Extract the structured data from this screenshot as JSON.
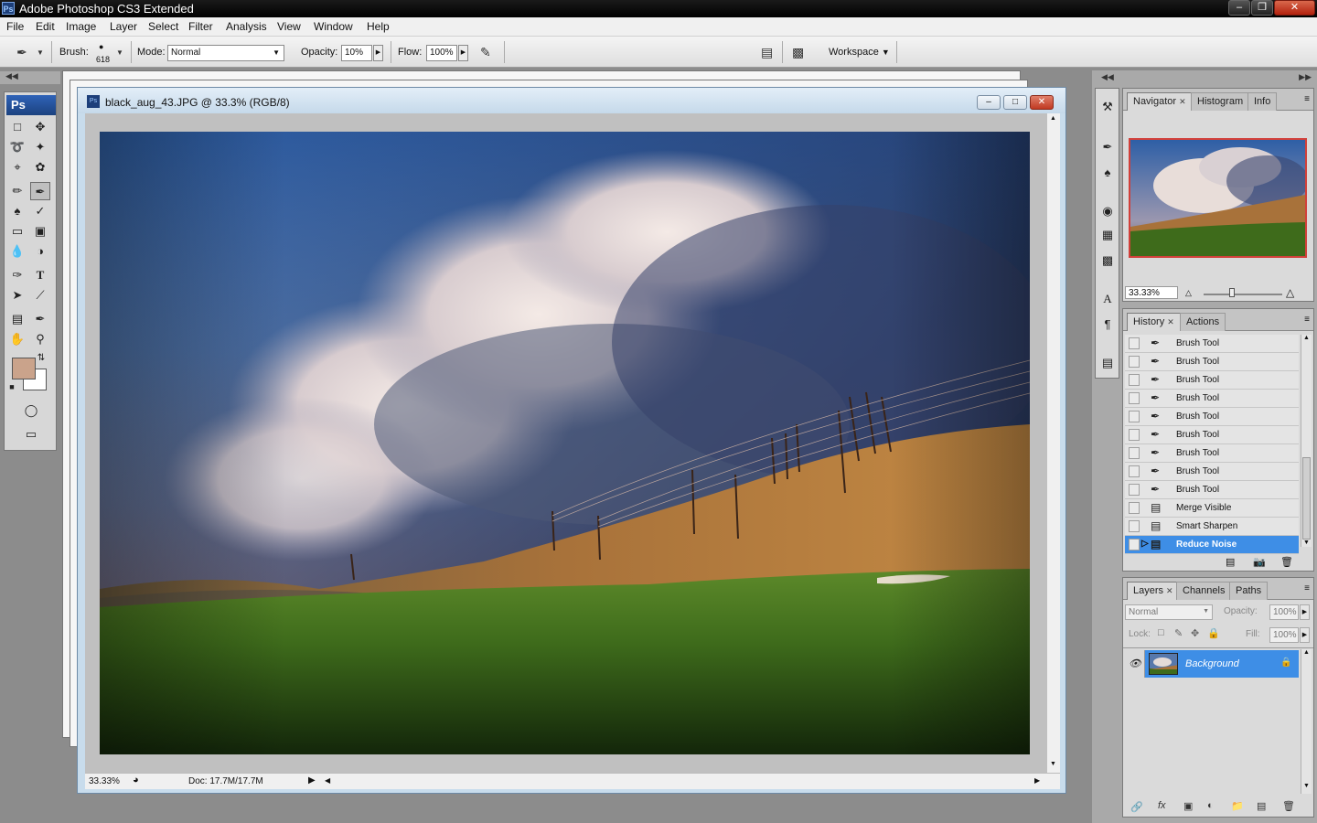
{
  "app": {
    "title": "Adobe Photoshop CS3 Extended",
    "badge": "Ps"
  },
  "menu": [
    "File",
    "Edit",
    "Image",
    "Layer",
    "Select",
    "Filter",
    "Analysis",
    "View",
    "Window",
    "Help"
  ],
  "options": {
    "brush_label": "Brush:",
    "brush_size": "618",
    "mode_label": "Mode:",
    "mode_value": "Normal",
    "opacity_label": "Opacity:",
    "opacity_value": "10%",
    "flow_label": "Flow:",
    "flow_value": "100%",
    "workspace_label": "Workspace"
  },
  "toolbox": {
    "badge": "Ps",
    "fg_color": "#caa38b",
    "bg_color": "#ffffff"
  },
  "document": {
    "title": "black_aug_43.JPG @ 33.3% (RGB/8)",
    "zoom": "33.33%",
    "doc_size": "Doc: 17.7M/17.7M"
  },
  "navigator": {
    "tabs": [
      "Navigator",
      "Histogram",
      "Info"
    ],
    "zoom": "33.33%"
  },
  "history": {
    "tabs": [
      "History",
      "Actions"
    ],
    "items": [
      {
        "label": "Brush Tool",
        "icon": "brush-icon"
      },
      {
        "label": "Brush Tool",
        "icon": "brush-icon"
      },
      {
        "label": "Brush Tool",
        "icon": "brush-icon"
      },
      {
        "label": "Brush Tool",
        "icon": "brush-icon"
      },
      {
        "label": "Brush Tool",
        "icon": "brush-icon"
      },
      {
        "label": "Brush Tool",
        "icon": "brush-icon"
      },
      {
        "label": "Brush Tool",
        "icon": "brush-icon"
      },
      {
        "label": "Brush Tool",
        "icon": "brush-icon"
      },
      {
        "label": "Brush Tool",
        "icon": "brush-icon"
      },
      {
        "label": "Merge Visible",
        "icon": "document-icon"
      },
      {
        "label": "Smart Sharpen",
        "icon": "document-icon"
      },
      {
        "label": "Reduce Noise",
        "icon": "document-icon",
        "selected": true
      }
    ]
  },
  "layers": {
    "tabs": [
      "Layers",
      "Channels",
      "Paths"
    ],
    "blend_mode": "Normal",
    "opacity_label": "Opacity:",
    "opacity_value": "100%",
    "lock_label": "Lock:",
    "fill_label": "Fill:",
    "fill_value": "100%",
    "items": [
      {
        "name": "Background",
        "visible": true,
        "locked": true
      }
    ]
  },
  "colors": {
    "selection": "#3e8ee6",
    "titlebar": "#000000"
  }
}
